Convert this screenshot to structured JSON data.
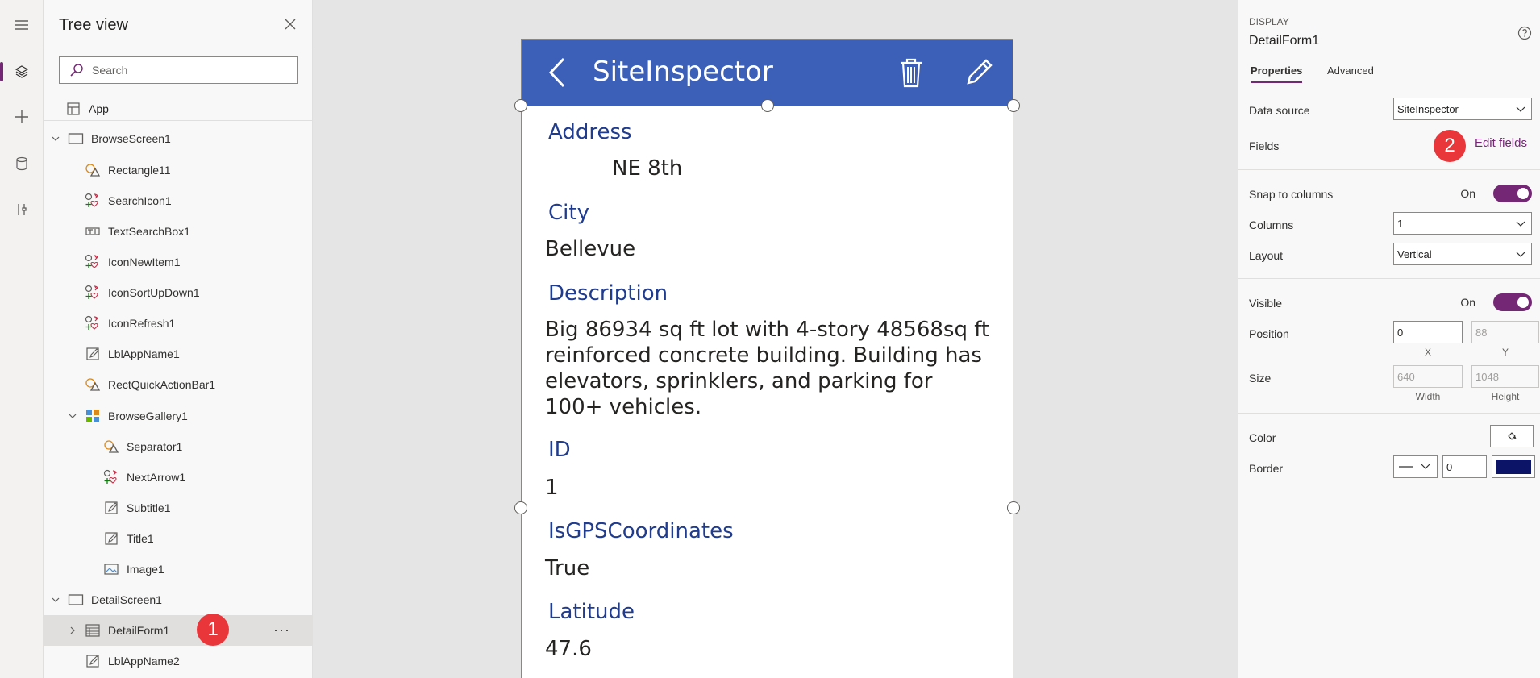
{
  "tree": {
    "title": "Tree view",
    "search_placeholder": "Search",
    "app_label": "App",
    "items": [
      {
        "label": "BrowseScreen1",
        "icon": "screen-icon"
      },
      {
        "label": "Rectangle11",
        "icon": "shape-icon"
      },
      {
        "label": "SearchIcon1",
        "icon": "icons-control-icon"
      },
      {
        "label": "TextSearchBox1",
        "icon": "textinput-icon"
      },
      {
        "label": "IconNewItem1",
        "icon": "icons-control-icon"
      },
      {
        "label": "IconSortUpDown1",
        "icon": "icons-control-icon"
      },
      {
        "label": "IconRefresh1",
        "icon": "icons-control-icon"
      },
      {
        "label": "LblAppName1",
        "icon": "label-icon"
      },
      {
        "label": "RectQuickActionBar1",
        "icon": "shape-icon"
      },
      {
        "label": "BrowseGallery1",
        "icon": "gallery-icon"
      },
      {
        "label": "Separator1",
        "icon": "shape-icon"
      },
      {
        "label": "NextArrow1",
        "icon": "icons-control-icon"
      },
      {
        "label": "Subtitle1",
        "icon": "label-icon"
      },
      {
        "label": "Title1",
        "icon": "label-icon"
      },
      {
        "label": "Image1",
        "icon": "image-icon"
      },
      {
        "label": "DetailScreen1",
        "icon": "screen-icon"
      },
      {
        "label": "DetailForm1",
        "icon": "form-icon"
      },
      {
        "label": "LblAppName2",
        "icon": "label-icon"
      }
    ],
    "more_glyph": "···",
    "badge1": "1"
  },
  "phone": {
    "app_title": "SiteInspector",
    "fields": [
      {
        "label": "Address",
        "value": "NE 8th"
      },
      {
        "label": "City",
        "value": "Bellevue"
      },
      {
        "label": "Description",
        "value": "Big 86934 sq ft lot with 4-story 48568sq ft reinforced concrete building. Building has elevators, sprinklers, and parking for 100+ vehicles."
      },
      {
        "label": "ID",
        "value": "1"
      },
      {
        "label": "IsGPSCoordinates",
        "value": "True"
      },
      {
        "label": "Latitude",
        "value": "47.6"
      }
    ],
    "header_color": "#3c60b8"
  },
  "props": {
    "kind": "DISPLAY",
    "name": "DetailForm1",
    "tabs": [
      "Properties",
      "Advanced"
    ],
    "data_source_label": "Data source",
    "data_source_value": "SiteInspector",
    "fields_label": "Fields",
    "edit_fields": "Edit fields",
    "badge2": "2",
    "snap_label": "Snap to columns",
    "snap_state": "On",
    "columns_label": "Columns",
    "columns_value": "1",
    "layout_label": "Layout",
    "layout_value": "Vertical",
    "visible_label": "Visible",
    "visible_state": "On",
    "position_label": "Position",
    "position_x": "0",
    "position_y": "88",
    "x_caption": "X",
    "y_caption": "Y",
    "size_label": "Size",
    "size_width": "640",
    "size_height": "1048",
    "width_caption": "Width",
    "height_caption": "Height",
    "color_label": "Color",
    "border_label": "Border",
    "border_width": "0",
    "border_color": "#0b1466",
    "accent": "#742774"
  }
}
